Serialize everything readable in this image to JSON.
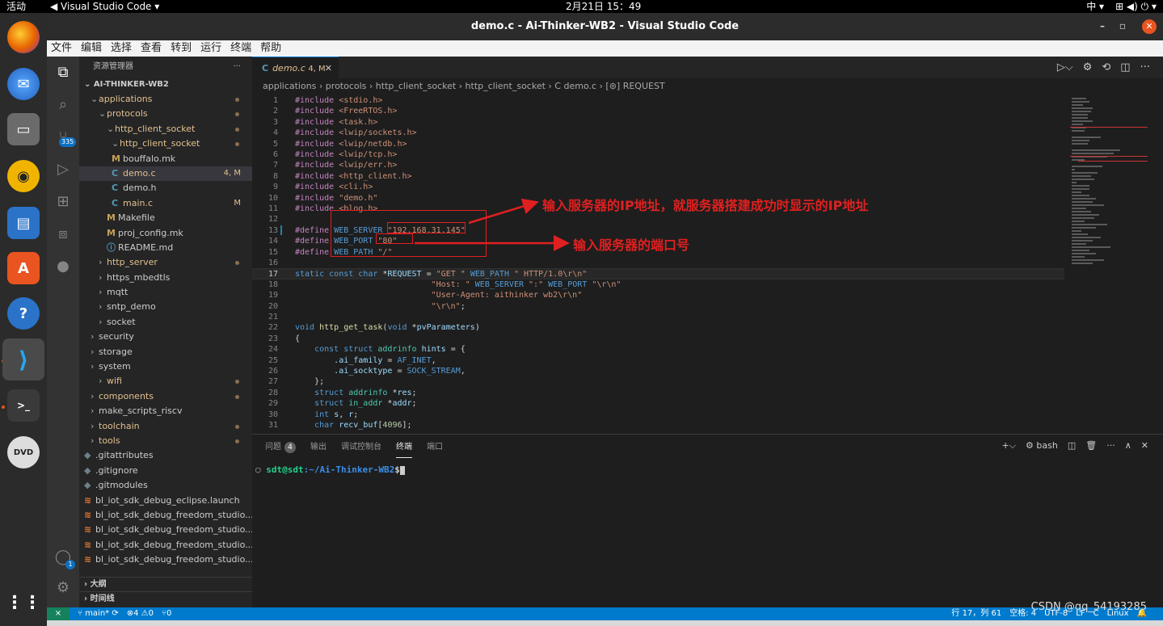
{
  "system": {
    "activities": "活动",
    "app_menu": "Visual Studio Code ▾",
    "clock": "2月21日  15：49",
    "tray": [
      "中 ▾",
      "⊞ ◀) ⏻ ▾"
    ]
  },
  "window": {
    "title": "demo.c - Ai-Thinker-WB2 - Visual Studio Code",
    "minimize": "–",
    "maximize": "▫",
    "close": "✕"
  },
  "menu": [
    "文件",
    "编辑",
    "选择",
    "查看",
    "转到",
    "运行",
    "终端",
    "帮助"
  ],
  "activity": {
    "scm_badge": "335",
    "account_badge": "1"
  },
  "explorer": {
    "header": "资源管理器",
    "more": "···",
    "root": "AI-THINKER-WB2",
    "items": [
      {
        "label": "applications",
        "arrow": "⌄",
        "icon": "",
        "badge": "",
        "dot": true
      },
      {
        "label": "protocols",
        "arrow": "⌄",
        "icon": "",
        "badge": "",
        "dot": true
      },
      {
        "label": "http_client_socket",
        "arrow": "⌄",
        "icon": "",
        "badge": "",
        "dot": true
      },
      {
        "label": "http_client_socket",
        "arrow": "⌄",
        "icon": "",
        "badge": "",
        "dot": true
      },
      {
        "label": "bouffalo.mk",
        "arrow": "",
        "icon": "M",
        "badge": "",
        "dot": false
      },
      {
        "label": "demo.c",
        "arrow": "",
        "icon": "C",
        "badge": "4, M",
        "dot": false
      },
      {
        "label": "demo.h",
        "arrow": "",
        "icon": "C",
        "badge": "",
        "dot": false
      },
      {
        "label": "main.c",
        "arrow": "",
        "icon": "C",
        "badge": "M",
        "dot": false
      },
      {
        "label": "Makefile",
        "arrow": "",
        "icon": "M",
        "badge": "",
        "dot": false
      },
      {
        "label": "proj_config.mk",
        "arrow": "",
        "icon": "M",
        "badge": "",
        "dot": false
      },
      {
        "label": "README.md",
        "arrow": "",
        "icon": "ⓘ",
        "badge": "",
        "dot": false
      },
      {
        "label": "http_server",
        "arrow": "›",
        "icon": "",
        "badge": "",
        "dot": true
      },
      {
        "label": "https_mbedtls",
        "arrow": "›",
        "icon": "",
        "badge": "",
        "dot": false
      },
      {
        "label": "mqtt",
        "arrow": "›",
        "icon": "",
        "badge": "",
        "dot": false
      },
      {
        "label": "sntp_demo",
        "arrow": "›",
        "icon": "",
        "badge": "",
        "dot": false
      },
      {
        "label": "socket",
        "arrow": "›",
        "icon": "",
        "badge": "",
        "dot": false
      },
      {
        "label": "security",
        "arrow": "›",
        "icon": "",
        "badge": "",
        "dot": false
      },
      {
        "label": "storage",
        "arrow": "›",
        "icon": "",
        "badge": "",
        "dot": false
      },
      {
        "label": "system",
        "arrow": "›",
        "icon": "",
        "badge": "",
        "dot": false
      },
      {
        "label": "wifi",
        "arrow": "›",
        "icon": "",
        "badge": "",
        "dot": true
      },
      {
        "label": "components",
        "arrow": "›",
        "icon": "",
        "badge": "",
        "dot": true
      },
      {
        "label": "make_scripts_riscv",
        "arrow": "›",
        "icon": "",
        "badge": "",
        "dot": false
      },
      {
        "label": "toolchain",
        "arrow": "›",
        "icon": "",
        "badge": "",
        "dot": true
      },
      {
        "label": "tools",
        "arrow": "›",
        "icon": "",
        "badge": "",
        "dot": true
      },
      {
        "label": ".gitattributes",
        "arrow": "",
        "icon": "◆",
        "badge": "",
        "dot": false
      },
      {
        "label": ".gitignore",
        "arrow": "",
        "icon": "◆",
        "badge": "",
        "dot": false
      },
      {
        "label": ".gitmodules",
        "arrow": "",
        "icon": "◆",
        "badge": "",
        "dot": false
      },
      {
        "label": "bl_iot_sdk_debug_eclipse.launch",
        "arrow": "",
        "icon": "≋",
        "badge": "",
        "dot": false
      },
      {
        "label": "bl_iot_sdk_debug_freedom_studio...",
        "arrow": "",
        "icon": "≋",
        "badge": "",
        "dot": false
      },
      {
        "label": "bl_iot_sdk_debug_freedom_studio...",
        "arrow": "",
        "icon": "≋",
        "badge": "",
        "dot": false
      },
      {
        "label": "bl_iot_sdk_debug_freedom_studio...",
        "arrow": "",
        "icon": "≋",
        "badge": "",
        "dot": false
      },
      {
        "label": "bl_iot_sdk_debug_freedom_studio...",
        "arrow": "",
        "icon": "≋",
        "badge": "",
        "dot": false
      }
    ],
    "outline": "大纲",
    "timeline": "时间线"
  },
  "editor": {
    "tab_label": "demo.c",
    "tab_status": "4, M",
    "tab_close": "✕",
    "breadcrumbs": "applications › protocols › http_client_socket › http_client_socket › C  demo.c › [⊚] REQUEST",
    "lines": [
      "#include <stdio.h>",
      "#include <FreeRTOS.h>",
      "#include <task.h>",
      "#include <lwip/sockets.h>",
      "#include <lwip/netdb.h>",
      "#include <lwip/tcp.h>",
      "#include <lwip/err.h>",
      "#include <http_client.h>",
      "#include <cli.h>",
      "#include \"demo.h\"",
      "#include <blog.h>",
      "",
      "#define WEB_SERVER \"192.168.31.145\"",
      "#define WEB_PORT \"80\"",
      "#define WEB_PATH \"/\"",
      "",
      "static const char *REQUEST = \"GET \" WEB_PATH \" HTTP/1.0\\r\\n\"",
      "                            \"Host: \" WEB_SERVER \":\" WEB_PORT \"\\r\\n\"",
      "                            \"User-Agent: aithinker wb2\\r\\n\"",
      "                            \"\\r\\n\";",
      "",
      "void http_get_task(void *pvParameters)",
      "{",
      "    const struct addrinfo hints = {",
      "        .ai_family = AF_INET,",
      "        .ai_socktype = SOCK_STREAM,",
      "    };",
      "    struct addrinfo *res;",
      "    struct in_addr *addr;",
      "    int s, r;",
      "    char recv_buf[4096];"
    ],
    "current_line": 17
  },
  "annotations": {
    "ip_note": "输入服务器的IP地址，就服务器搭建成功时显示的IP地址",
    "port_note": "输入服务器的端口号",
    "color": "#e02020"
  },
  "panel": {
    "tabs": [
      "问题",
      "输出",
      "调试控制台",
      "终端",
      "端口"
    ],
    "problems_count": "4",
    "shell": "bash",
    "prompt_user": "sdt@sdt",
    "prompt_path": ":~/Ai-Thinker-WB2",
    "prompt_symbol": "$"
  },
  "status": {
    "branch": "main*",
    "errors": "⊗4 ⚠0",
    "ports": "⑂0",
    "position": "行 17，列 61",
    "spaces": "空格: 4",
    "encoding": "UTF-8",
    "eol": "LF",
    "language": "C",
    "platform": "Linux"
  },
  "watermark": "CSDN @qq_54193285",
  "colors": {
    "accent": "#007acc",
    "ubuntu_orange": "#e95420"
  }
}
